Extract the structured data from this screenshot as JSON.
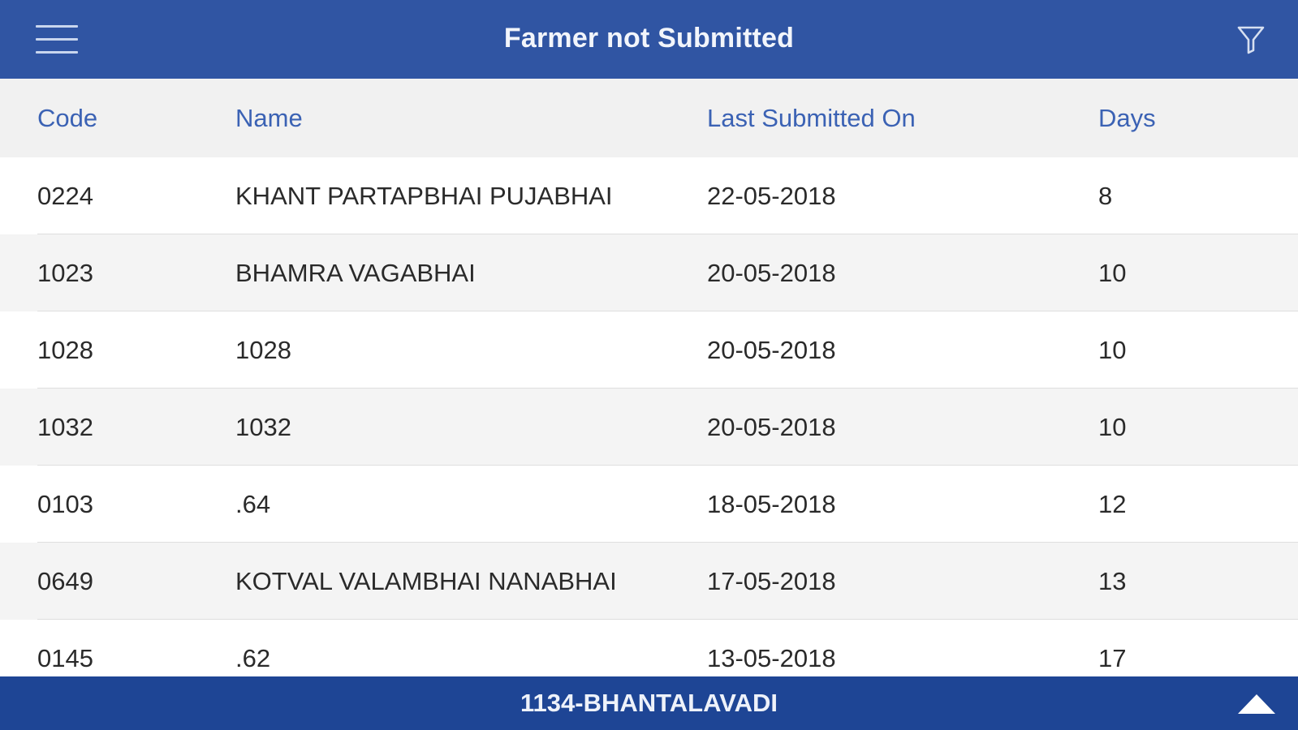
{
  "header": {
    "title": "Farmer not Submitted",
    "menu_icon": "hamburger-menu-icon",
    "filter_icon": "filter-funnel-icon",
    "background_color": "#3055a3"
  },
  "table": {
    "columns": [
      "Code",
      "Name",
      "Last Submitted On",
      "Days"
    ],
    "rows": [
      {
        "code": "0224",
        "name": "KHANT PARTAPBHAI PUJABHAI",
        "last": "22-05-2018",
        "days": "8"
      },
      {
        "code": "1023",
        "name": "BHAMRA VAGABHAI",
        "last": "20-05-2018",
        "days": "10"
      },
      {
        "code": "1028",
        "name": "1028",
        "last": "20-05-2018",
        "days": "10"
      },
      {
        "code": "1032",
        "name": "1032",
        "last": "20-05-2018",
        "days": "10"
      },
      {
        "code": "0103",
        "name": ".64",
        "last": "18-05-2018",
        "days": "12"
      },
      {
        "code": "0649",
        "name": "KOTVAL VALAMBHAI NANABHAI",
        "last": "17-05-2018",
        "days": "13"
      },
      {
        "code": "0145",
        "name": ".62",
        "last": "13-05-2018",
        "days": "17"
      }
    ]
  },
  "footer": {
    "label": "1134-BHANTALAVADI",
    "expand_icon": "triangle-up-icon",
    "background_color": "#1e4595"
  }
}
